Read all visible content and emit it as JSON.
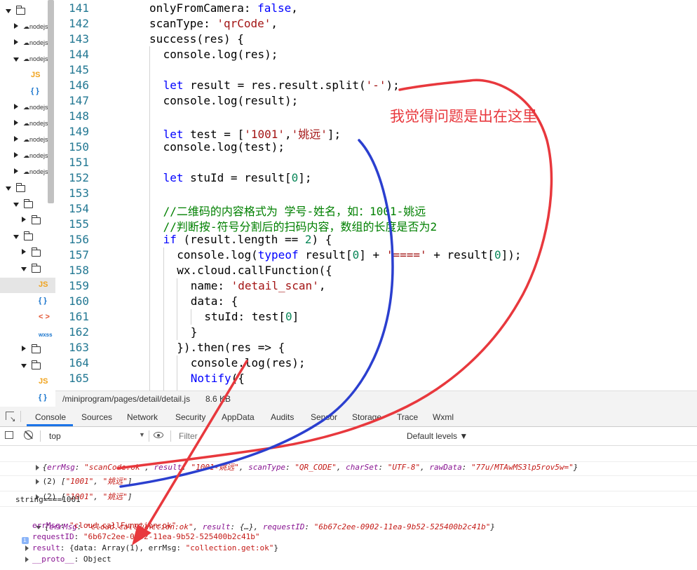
{
  "tree": {
    "items": [
      {
        "indent": 0,
        "arrow": "down",
        "icon": "folder-icon",
        "label": ""
      },
      {
        "indent": 1,
        "arrow": "right",
        "icon": "cloud-function-icon",
        "label": "nodejs"
      },
      {
        "indent": 1,
        "arrow": "right",
        "icon": "cloud-function-icon",
        "label": "nodejs"
      },
      {
        "indent": 1,
        "arrow": "down",
        "icon": "cloud-function-icon",
        "label": "nodejs"
      },
      {
        "indent": 2,
        "arrow": "",
        "icon": "js-file-icon",
        "label": "JS"
      },
      {
        "indent": 2,
        "arrow": "",
        "icon": "json-file-icon",
        "label": "{ }"
      },
      {
        "indent": 1,
        "arrow": "right",
        "icon": "cloud-function-icon",
        "label": "nodejs"
      },
      {
        "indent": 1,
        "arrow": "right",
        "icon": "cloud-function-icon",
        "label": "nodejs"
      },
      {
        "indent": 1,
        "arrow": "right",
        "icon": "cloud-function-icon",
        "label": "nodejs"
      },
      {
        "indent": 1,
        "arrow": "right",
        "icon": "cloud-function-icon",
        "label": "nodejs"
      },
      {
        "indent": 1,
        "arrow": "right",
        "icon": "cloud-function-icon",
        "label": "nodejs"
      },
      {
        "indent": 0,
        "arrow": "down",
        "icon": "folder-icon",
        "label": ""
      },
      {
        "indent": 1,
        "arrow": "down",
        "icon": "folder-icon",
        "label": ""
      },
      {
        "indent": 2,
        "arrow": "right",
        "icon": "folder-icon",
        "label": ""
      },
      {
        "indent": 1,
        "arrow": "down",
        "icon": "folder-icon",
        "label": ""
      },
      {
        "indent": 2,
        "arrow": "right",
        "icon": "folder-icon",
        "label": ""
      },
      {
        "indent": 2,
        "arrow": "down",
        "icon": "folder-icon",
        "label": ""
      },
      {
        "indent": 3,
        "arrow": "",
        "icon": "js-file-icon",
        "label": "JS",
        "selected": true
      },
      {
        "indent": 3,
        "arrow": "",
        "icon": "json-file-icon",
        "label": "{ }"
      },
      {
        "indent": 3,
        "arrow": "",
        "icon": "wxml-file-icon",
        "label": "< >"
      },
      {
        "indent": 3,
        "arrow": "",
        "icon": "wxss-file-icon",
        "label": "wxss"
      },
      {
        "indent": 2,
        "arrow": "right",
        "icon": "folder-icon",
        "label": ""
      },
      {
        "indent": 2,
        "arrow": "down",
        "icon": "folder-icon",
        "label": ""
      },
      {
        "indent": 3,
        "arrow": "",
        "icon": "js-file-icon",
        "label": "JS"
      },
      {
        "indent": 3,
        "arrow": "",
        "icon": "json-file-icon",
        "label": "{ }"
      }
    ]
  },
  "editor": {
    "lines": [
      {
        "n": "141",
        "indent": 6,
        "tokens": [
          [
            "p",
            "onlyFromCamera: "
          ],
          [
            "kw",
            "false"
          ],
          [
            "p",
            ","
          ]
        ]
      },
      {
        "n": "142",
        "indent": 6,
        "tokens": [
          [
            "p",
            "scanType: "
          ],
          [
            "str",
            "'qrCode'"
          ],
          [
            "p",
            ","
          ]
        ]
      },
      {
        "n": "143",
        "indent": 6,
        "tokens": [
          [
            "p",
            "success(res) {"
          ]
        ]
      },
      {
        "n": "144",
        "indent": 8,
        "tokens": [
          [
            "p",
            "console.log(res);"
          ]
        ]
      },
      {
        "n": "145",
        "indent": 8,
        "tokens": []
      },
      {
        "n": "146",
        "indent": 8,
        "tokens": [
          [
            "kw",
            "let"
          ],
          [
            "p",
            " result = res.result.split("
          ],
          [
            "str",
            "'-'"
          ],
          [
            "p",
            ");"
          ]
        ]
      },
      {
        "n": "147",
        "indent": 8,
        "tokens": [
          [
            "p",
            "console.log(result);"
          ]
        ]
      },
      {
        "n": "148",
        "indent": 8,
        "tokens": []
      },
      {
        "n": "149",
        "indent": 8,
        "tokens": [
          [
            "kw",
            "let"
          ],
          [
            "p",
            " test = ["
          ],
          [
            "str",
            "'1001'"
          ],
          [
            "p",
            ","
          ],
          [
            "str",
            "'姚远'"
          ],
          [
            "p",
            "];"
          ]
        ]
      },
      {
        "n": "150",
        "indent": 8,
        "tokens": [
          [
            "p",
            "console.log(test);"
          ]
        ]
      },
      {
        "n": "151",
        "indent": 8,
        "tokens": []
      },
      {
        "n": "152",
        "indent": 8,
        "tokens": [
          [
            "kw",
            "let"
          ],
          [
            "p",
            " stuId = result["
          ],
          [
            "num",
            "0"
          ],
          [
            "p",
            "];"
          ]
        ]
      },
      {
        "n": "153",
        "indent": 8,
        "tokens": []
      },
      {
        "n": "154",
        "indent": 8,
        "tokens": [
          [
            "cm",
            "//二维码的内容格式为 学号-姓名，如：1001-姚远"
          ]
        ]
      },
      {
        "n": "155",
        "indent": 8,
        "tokens": [
          [
            "cm",
            "//判断按-符号分割后的扫码内容，数组的长度是否为2"
          ]
        ]
      },
      {
        "n": "156",
        "indent": 8,
        "tokens": [
          [
            "kw",
            "if"
          ],
          [
            "p",
            " (result.length == "
          ],
          [
            "num",
            "2"
          ],
          [
            "p",
            ") {"
          ]
        ]
      },
      {
        "n": "157",
        "indent": 10,
        "tokens": [
          [
            "p",
            "console.log("
          ],
          [
            "kw",
            "typeof"
          ],
          [
            "p",
            " result["
          ],
          [
            "num",
            "0"
          ],
          [
            "p",
            "] + "
          ],
          [
            "str",
            "'===='"
          ],
          [
            "p",
            " + result["
          ],
          [
            "num",
            "0"
          ],
          [
            "p",
            "]);"
          ]
        ]
      },
      {
        "n": "158",
        "indent": 10,
        "tokens": [
          [
            "p",
            "wx.cloud.callFunction({"
          ]
        ]
      },
      {
        "n": "159",
        "indent": 12,
        "tokens": [
          [
            "p",
            "name: "
          ],
          [
            "str",
            "'detail_scan'"
          ],
          [
            "p",
            ","
          ]
        ]
      },
      {
        "n": "160",
        "indent": 12,
        "tokens": [
          [
            "p",
            "data: {"
          ]
        ]
      },
      {
        "n": "161",
        "indent": 14,
        "tokens": [
          [
            "p",
            "stuId: test["
          ],
          [
            "num",
            "0"
          ],
          [
            "p",
            "]"
          ]
        ]
      },
      {
        "n": "162",
        "indent": 12,
        "tokens": [
          [
            "p",
            "}"
          ]
        ]
      },
      {
        "n": "163",
        "indent": 10,
        "tokens": [
          [
            "p",
            "}).then(res => {"
          ]
        ]
      },
      {
        "n": "164",
        "indent": 12,
        "tokens": [
          [
            "p",
            "console.log(res);"
          ]
        ]
      },
      {
        "n": "165",
        "indent": 12,
        "tokens": [
          [
            "kw",
            "Notify"
          ],
          [
            "p",
            "({"
          ]
        ]
      }
    ]
  },
  "status": {
    "path": "/miniprogram/pages/detail/detail.js",
    "size": "8.6 KB"
  },
  "devtools": {
    "tabs": [
      "Console",
      "Sources",
      "Network",
      "Security",
      "AppData",
      "Audits",
      "Sensor",
      "Storage",
      "Trace",
      "Wxml"
    ],
    "active_tab": "Console",
    "context": "top",
    "filter_placeholder": "Filter",
    "levels": "Default levels ▼"
  },
  "console": {
    "row1": {
      "k1": "errMsg",
      "v1": "\"scanCode:ok\"",
      "k2": "result",
      "v2": "\"1001-姚远\"",
      "k3": "scanType",
      "v3": "\"QR_CODE\"",
      "k4": "charSet",
      "v4": "\"UTF-8\"",
      "k5": "rawData",
      "v5": "\"77u/MTAwMS3lp5rov5w=\""
    },
    "row2": {
      "len": "(2) ",
      "a": "\"1001\"",
      "b": "\"姚远\""
    },
    "row3": {
      "len": "(2) ",
      "a": "\"1001\"",
      "b": "\"姚远\""
    },
    "row4": "string====1001",
    "row5": {
      "k1": "errMsg",
      "v1": "\"cloud.callFunction:ok\"",
      "k2": "result",
      "v2": "{…}",
      "k3": "requestID",
      "v3": "\"6b67c2ee-0902-11ea-9b52-525400b2c41b\""
    },
    "row6": {
      "k": "errMsg",
      "v": "\"cloud.callFunction:ok\""
    },
    "row7": {
      "k": "requestID",
      "v": "\"6b67c2ee-0902-11ea-9b52-525400b2c41b\""
    },
    "row8": {
      "k": "result",
      "pre": "{data: ",
      "arr": "Array(1)",
      "mid": ", errMsg: ",
      "v": "\"collection.get:ok\"",
      "post": "}"
    },
    "row9": {
      "k": "__proto__",
      "v": "Object"
    }
  },
  "annotation": {
    "text": "我觉得问题是出在这里",
    "color": "#e8383d"
  }
}
